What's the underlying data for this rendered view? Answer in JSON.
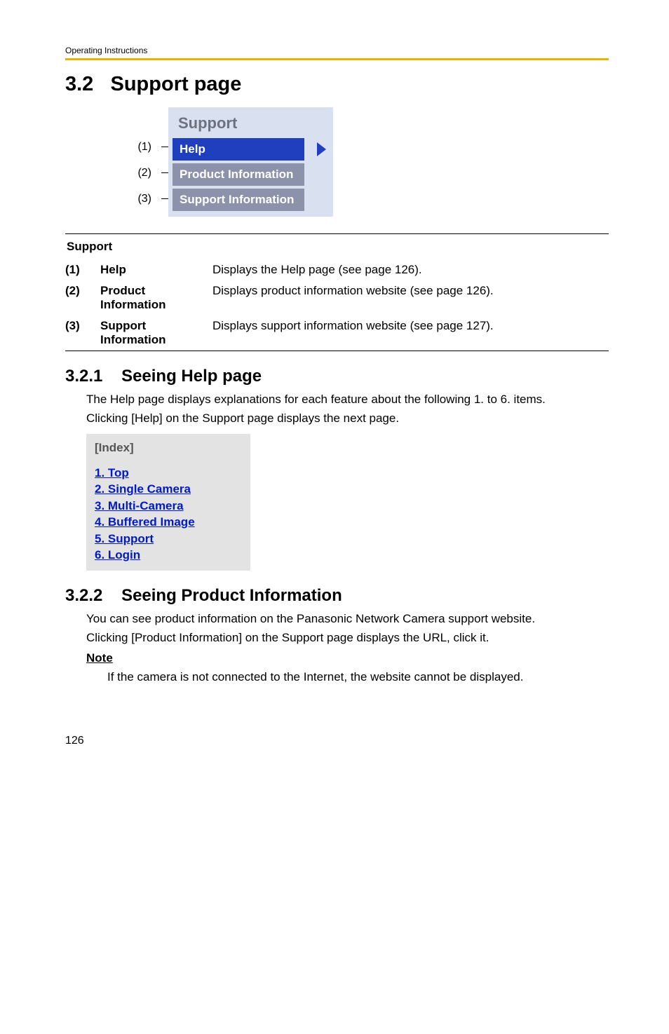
{
  "running_head": "Operating Instructions",
  "heading": {
    "num": "3.2",
    "title": "Support page"
  },
  "figure": {
    "title": "Support",
    "rows": [
      {
        "label": "(1)",
        "text": "Help",
        "style": "btn-help",
        "show_tri": true
      },
      {
        "label": "(2)",
        "text": "Product Information",
        "style": "btn-other",
        "show_tri": false
      },
      {
        "label": "(3)",
        "text": "Support Information",
        "style": "btn-other",
        "show_tri": false
      }
    ]
  },
  "table": {
    "section": "Support",
    "rows": [
      {
        "n": "(1)",
        "term": "Help",
        "desc": "Displays the Help page (see page 126)."
      },
      {
        "n": "(2)",
        "term": "Product Information",
        "desc": "Displays product information website (see page 126)."
      },
      {
        "n": "(3)",
        "term": "Support Information",
        "desc": "Displays support information website (see page 127)."
      }
    ]
  },
  "s321": {
    "num": "3.2.1",
    "title": "Seeing Help page",
    "para1": "The Help page displays explanations for each feature about the following 1. to 6. items.",
    "para2": "Clicking [Help] on the Support page displays the next page.",
    "index_title": "[Index]",
    "links": [
      "1. Top",
      "2. Single Camera",
      "3. Multi-Camera",
      "4. Buffered Image",
      "5. Support",
      "6. Login"
    ]
  },
  "s322": {
    "num": "3.2.2",
    "title": "Seeing Product Information",
    "para1": "You can see product information on the Panasonic Network Camera support website.",
    "para2": "Clicking [Product Information] on the Support page displays the URL, click it.",
    "note_head": "Note",
    "note_text": "If the camera is not connected to the Internet, the website cannot be displayed."
  },
  "page_number": "126"
}
